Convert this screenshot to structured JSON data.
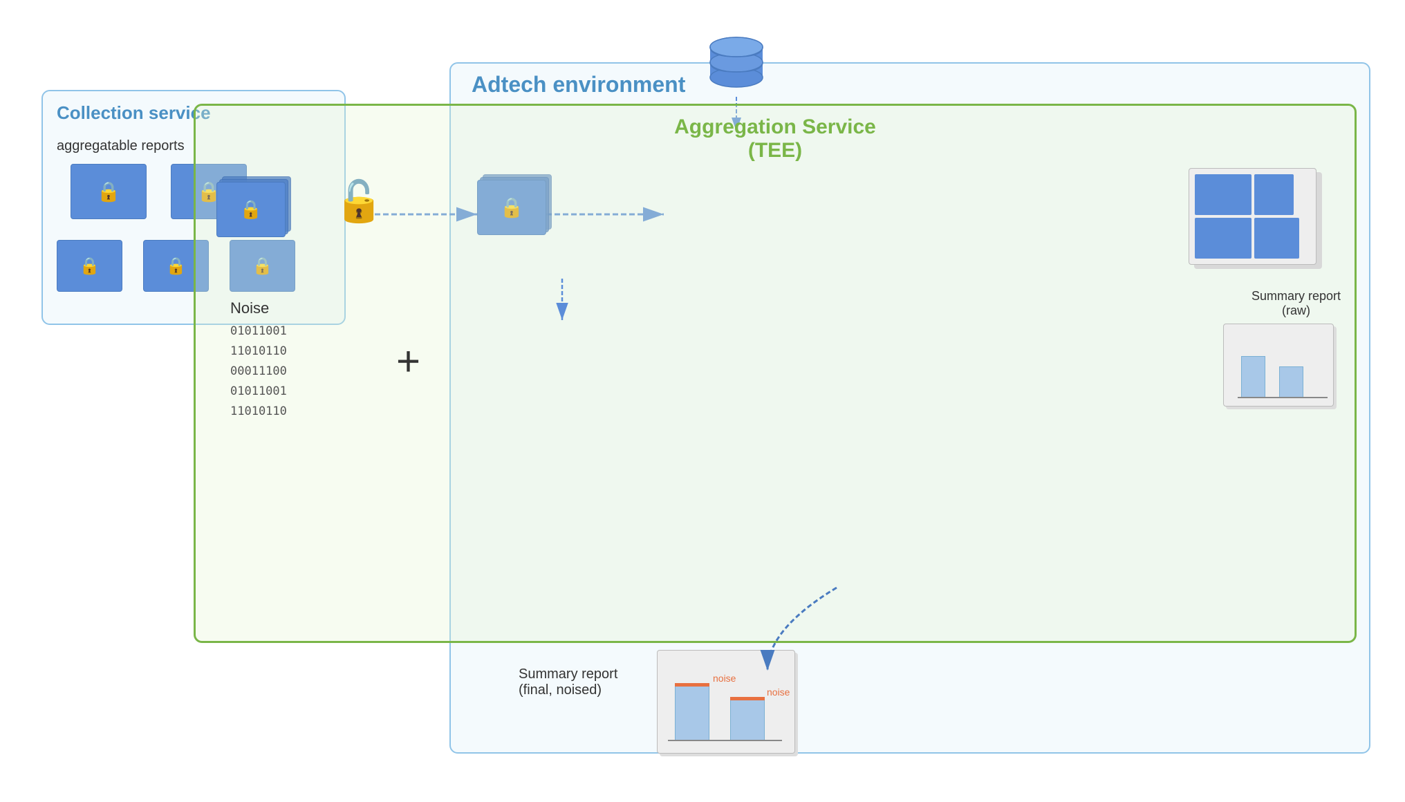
{
  "diagram": {
    "adtech_label": "Adtech environment",
    "collection_service": {
      "title": "Collection service",
      "subtitle": "aggregatable reports"
    },
    "aggregation_service": {
      "title": "Aggregation Service",
      "subtitle": "(TEE)"
    },
    "noise": {
      "label": "Noise",
      "binary_lines": [
        "01011001",
        "11010110",
        "00011100",
        "01011001",
        "11010110"
      ]
    },
    "summary_report_raw": {
      "label": "Summary report",
      "sublabel": "(raw)"
    },
    "summary_report_final": {
      "label": "Summary report",
      "sublabel": "(final, noised)"
    },
    "noise_markers": [
      "noise",
      "noise"
    ]
  }
}
